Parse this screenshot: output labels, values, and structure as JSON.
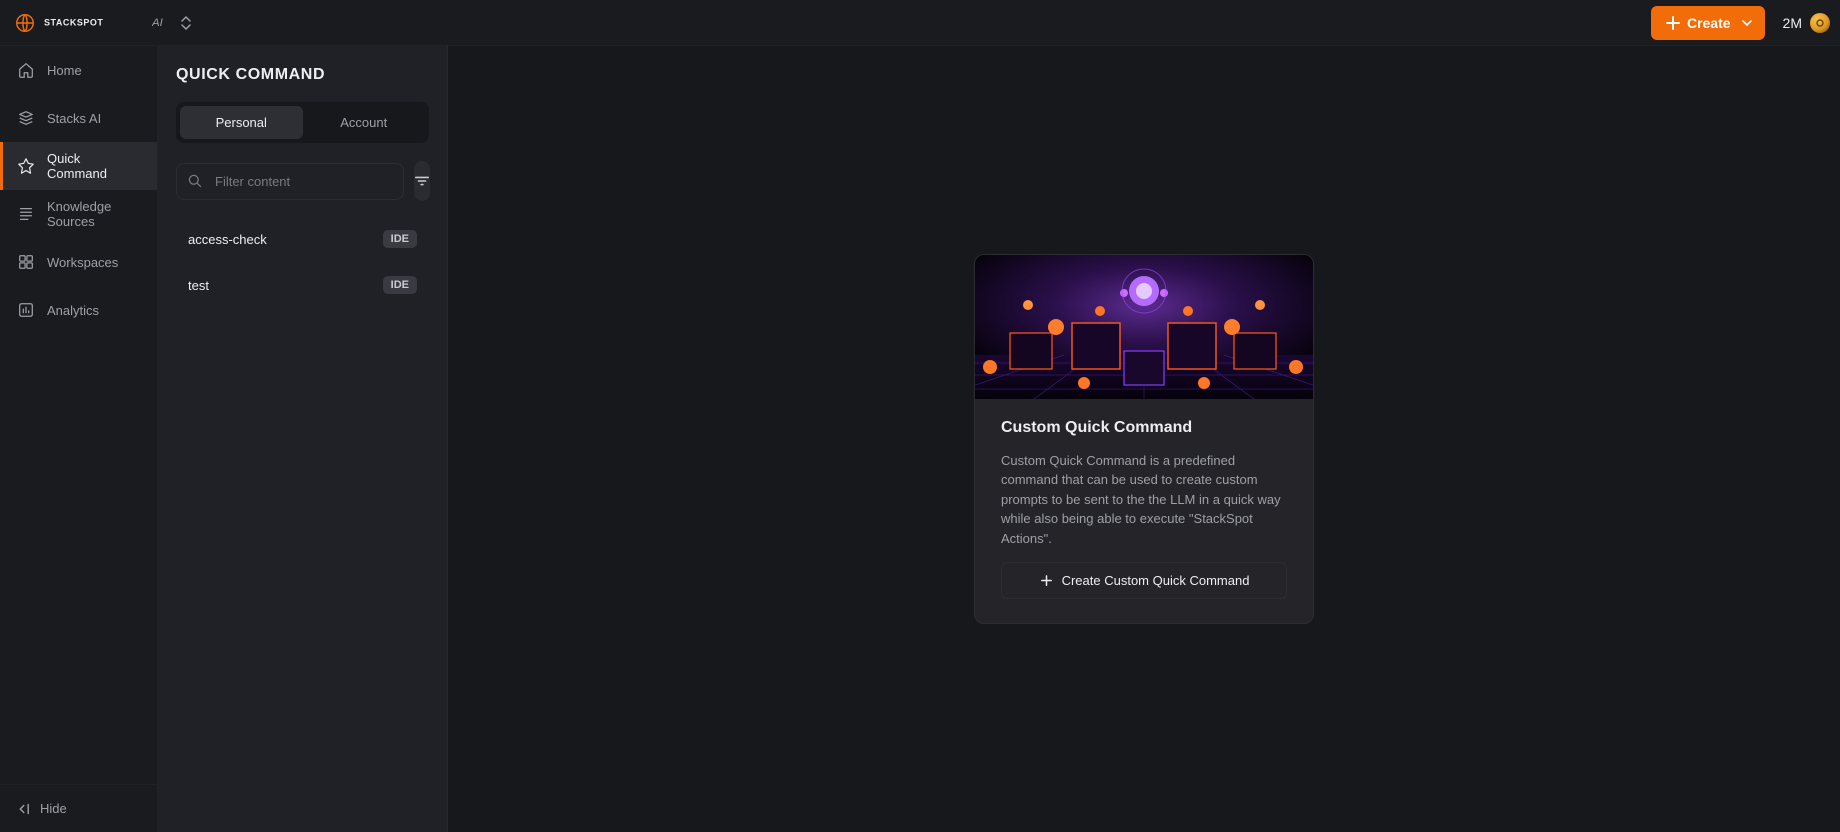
{
  "topbar": {
    "brand": "STACKSPOT",
    "brand_tag": "AI",
    "create_label": "Create",
    "token_amount": "2M"
  },
  "sidebar": {
    "items": [
      {
        "label": "Home"
      },
      {
        "label": "Stacks AI"
      },
      {
        "label": "Quick Command"
      },
      {
        "label": "Knowledge Sources"
      },
      {
        "label": "Workspaces"
      },
      {
        "label": "Analytics"
      }
    ],
    "hide_label": "Hide"
  },
  "second_col": {
    "title": "QUICK COMMAND",
    "tabs": {
      "personal": "Personal",
      "account": "Account"
    },
    "filter_placeholder": "Filter content",
    "items": [
      {
        "name": "access-check",
        "badge": "IDE"
      },
      {
        "name": "test",
        "badge": "IDE"
      }
    ]
  },
  "card": {
    "title": "Custom Quick Command",
    "desc": "Custom Quick Command is a predefined command that can be used to create custom prompts to be sent to the the LLM in a quick way while also being able to execute \"StackSpot Actions\".",
    "button": "Create Custom Quick Command"
  }
}
